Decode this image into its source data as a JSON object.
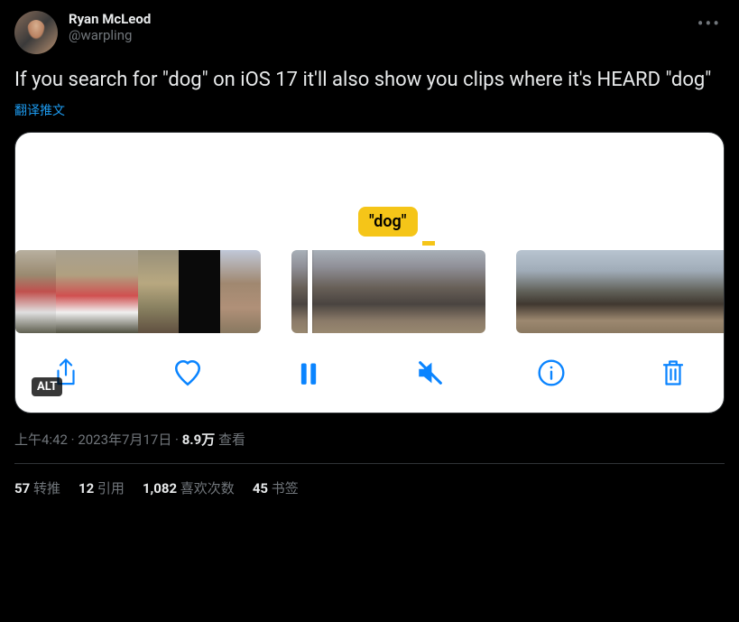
{
  "author": {
    "display_name": "Ryan McLeod",
    "handle": "@warpling"
  },
  "tweet_text": "If you search for \"dog\" on iOS 17 it'll also show you clips where it's HEARD \"dog\"",
  "translate_label": "翻译推文",
  "media": {
    "tooltip": "\"dog\"",
    "alt_badge": "ALT"
  },
  "meta": {
    "time": "上午4:42",
    "date": "2023年7月17日",
    "views_count": "8.9万",
    "views_label": "查看",
    "separator": " · "
  },
  "stats": {
    "retweets": {
      "count": "57",
      "label": "转推"
    },
    "quotes": {
      "count": "12",
      "label": "引用"
    },
    "likes": {
      "count": "1,082",
      "label": "喜欢次数"
    },
    "bookmarks": {
      "count": "45",
      "label": "书签"
    }
  }
}
